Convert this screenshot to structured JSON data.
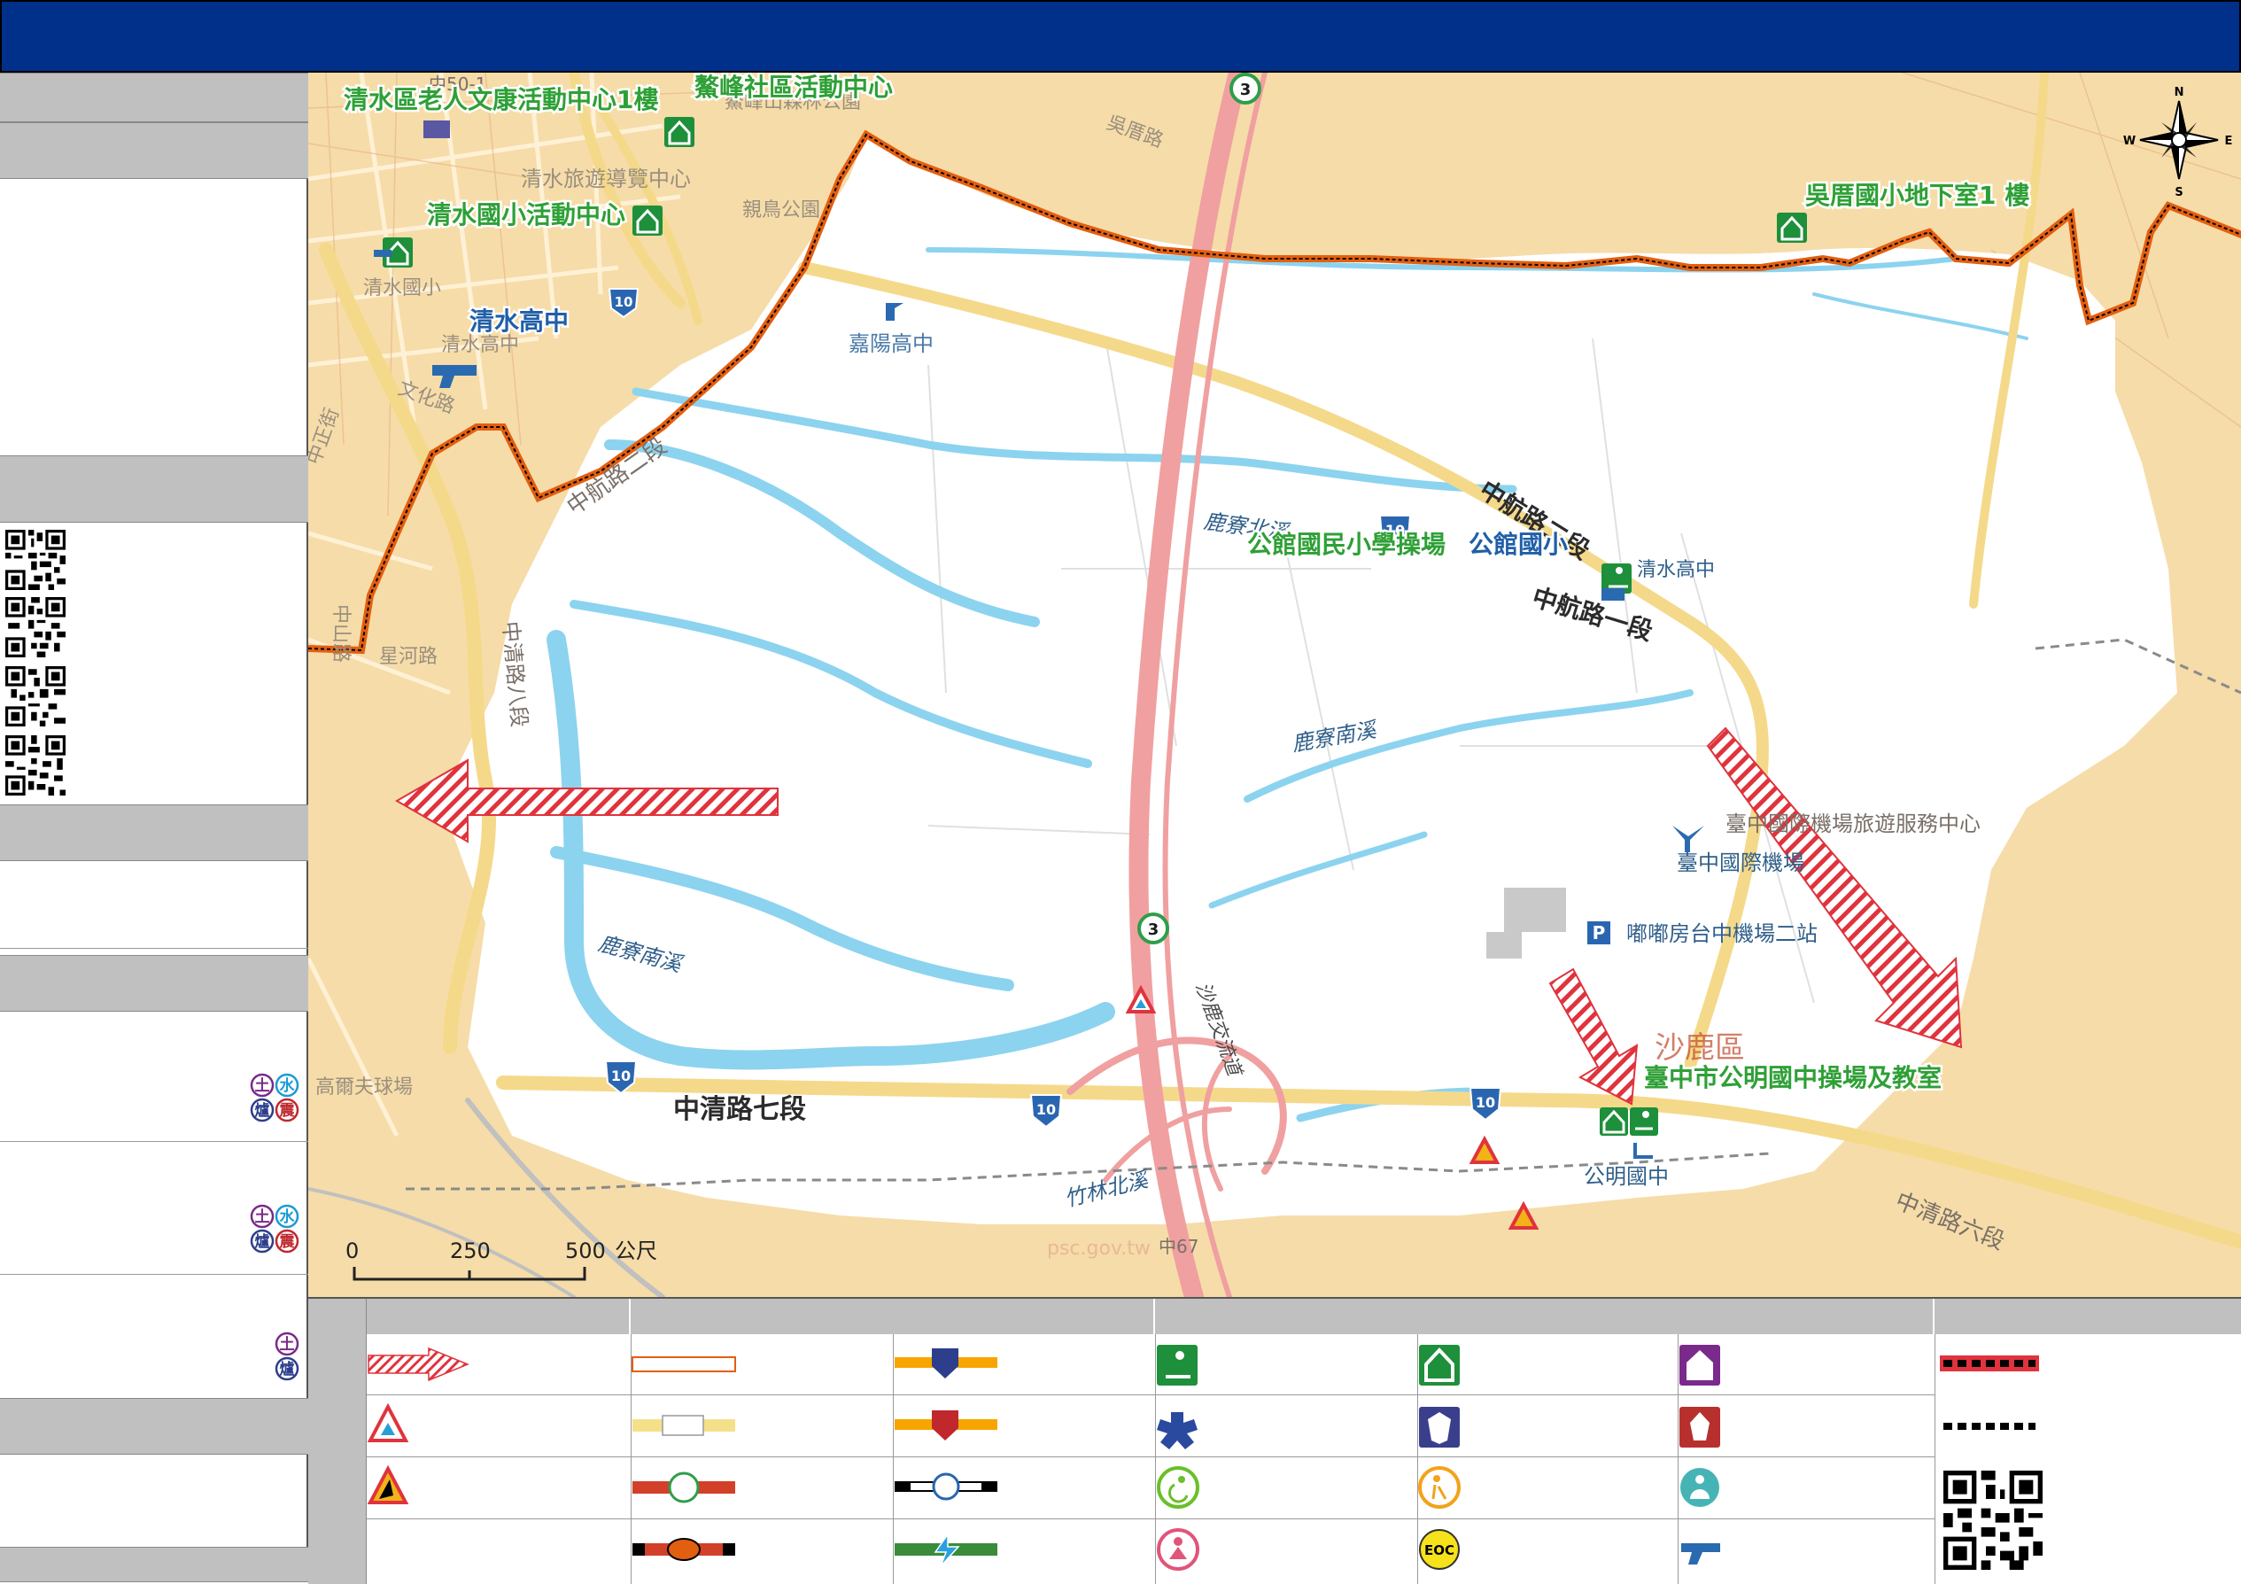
{
  "header": {
    "title": ""
  },
  "colors": {
    "header_bg": "#00308a",
    "panel_grey": "#c0c0c0",
    "boundary": "#e35f10",
    "river": "#8cd3ef",
    "shelter_green": "#1e8f3a",
    "evac_arrow": "#e0333d",
    "label_green": "#2ea036",
    "label_blue": "#1f6fb8"
  },
  "compass": {
    "n": "N",
    "s": "S",
    "e": "E",
    "w": "W"
  },
  "map": {
    "shelters": [
      "清水區老人文康活動中心1樓",
      "鰲峰社區活動中心",
      "清水國小活動中心",
      "吳厝國小地下室1 樓",
      "公館國民小學操場",
      "臺中市公明國中操場及教室"
    ],
    "schools_blue": [
      "清水高中",
      "公館國小"
    ],
    "base_labels": [
      "清水旅遊導覽中心",
      "鰲峰山森林公園",
      "親鳥公園",
      "清水國小",
      "清水高中",
      "嘉陽高中",
      "文化路",
      "中正街",
      "中山路",
      "星河路",
      "中清路八段",
      "中航路二段",
      "中航路一段",
      "中清路七段",
      "中清路六段",
      "鹿寮北溪",
      "鹿寮南溪",
      "竹林北溪",
      "沙鹿交流道",
      "吳厝路",
      "臺中國際機場旅遊服務中心",
      "臺中國際機場",
      "嘟嘟房台中機場二站",
      "沙鹿區",
      "公明國中",
      "高爾夫球場",
      "中50-1",
      "中67",
      "psc.gov.tw"
    ],
    "route_shields": [
      "3",
      "10"
    ],
    "scale": {
      "ticks": [
        "0",
        "250",
        "500"
      ],
      "unit": "公尺"
    }
  },
  "sidebar": {
    "hazard_badges": [
      "土",
      "水",
      "爐",
      "震"
    ]
  },
  "legend": {
    "icons_col_a": [
      "evac-arrow",
      "flood-warning",
      "landslide-warning",
      ""
    ],
    "icons_col_b": [
      "town-road",
      "county-road",
      "provincial-road",
      "expressway"
    ],
    "icons_col_c": [
      "police-station",
      "fire-station",
      "railway-station",
      "hsr-station"
    ],
    "icons_col_d": [
      "outdoor-shelter",
      "medical",
      "disabled-care",
      "women-child"
    ],
    "icons_col_e": [
      "indoor-shelter",
      "police-office",
      "elderly-care",
      "eoc"
    ],
    "icons_col_f": [
      "village-office",
      "fire-brigade",
      "baby-care",
      "helipad"
    ],
    "eoc_text": "EOC"
  }
}
